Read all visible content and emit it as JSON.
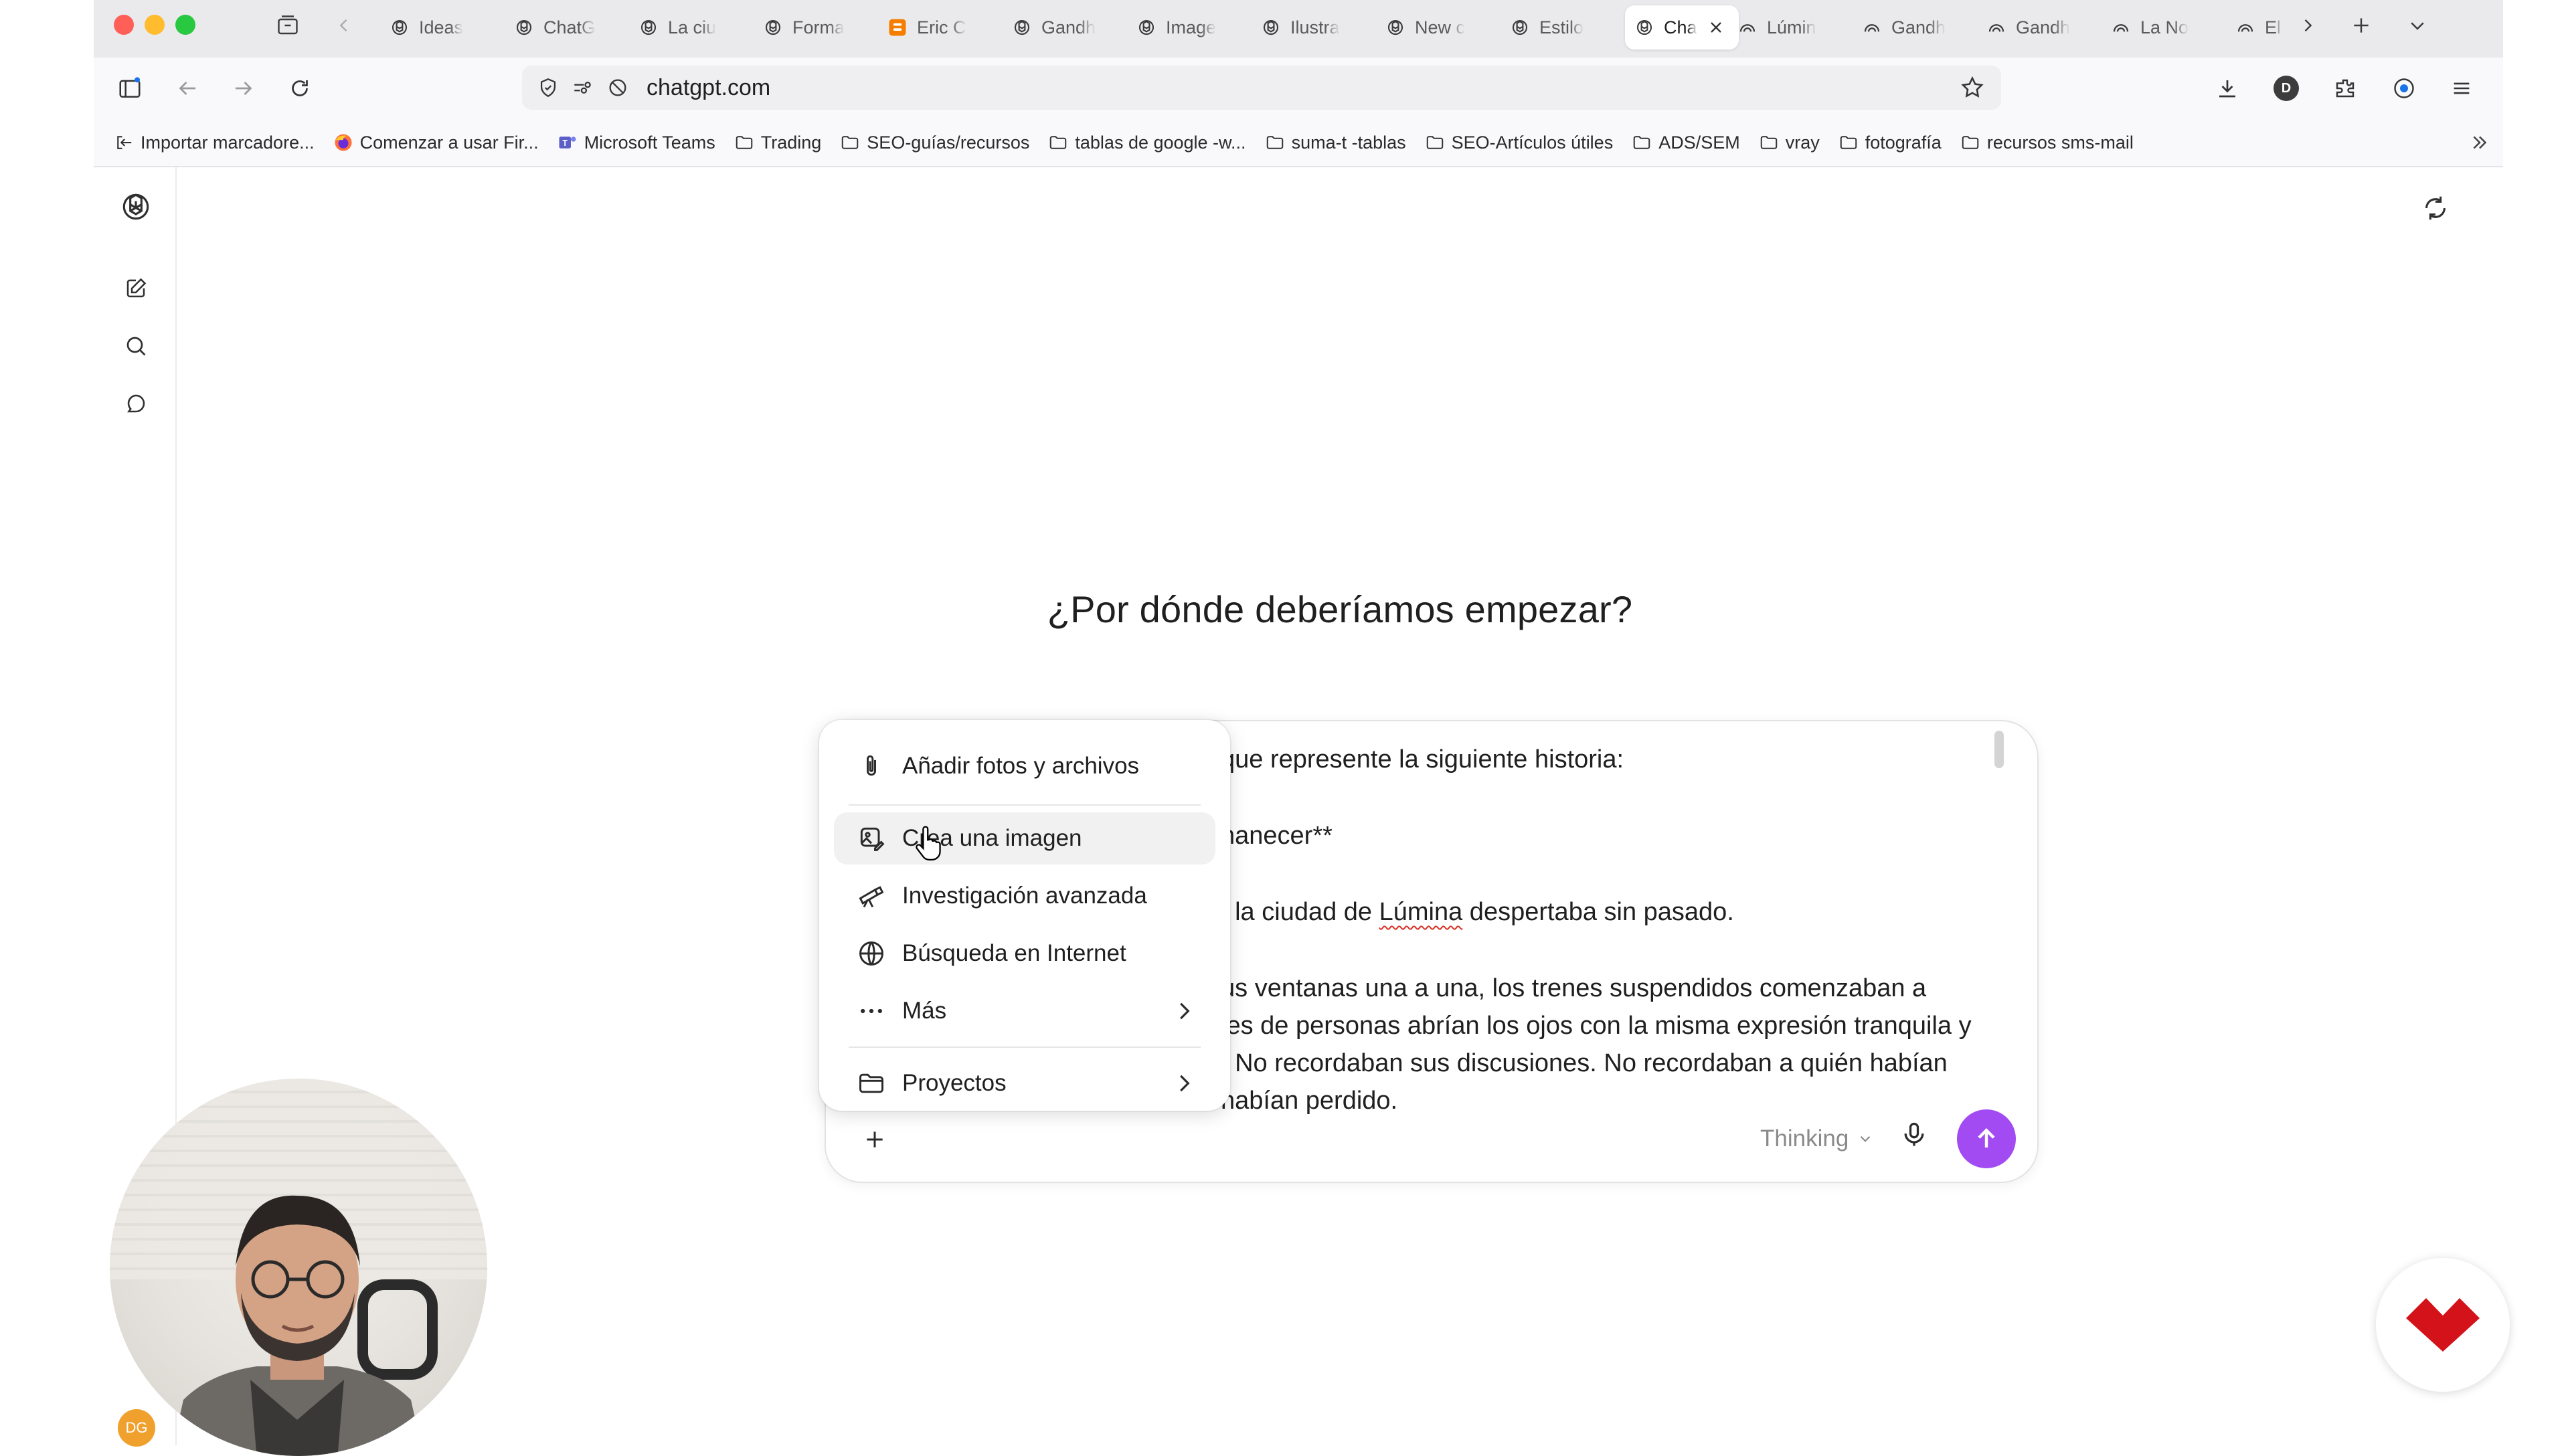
{
  "browser": {
    "tabs": [
      {
        "label": "Ideas",
        "icon": "openai-icon"
      },
      {
        "label": "ChatG",
        "icon": "openai-icon"
      },
      {
        "label": "La ciu",
        "icon": "openai-icon"
      },
      {
        "label": "Forma",
        "icon": "openai-icon"
      },
      {
        "label": "Eric C",
        "icon": "blogger-icon"
      },
      {
        "label": "Gandh",
        "icon": "openai-icon"
      },
      {
        "label": "Image",
        "icon": "openai-icon"
      },
      {
        "label": "Ilustra",
        "icon": "openai-icon"
      },
      {
        "label": "New c",
        "icon": "openai-icon"
      },
      {
        "label": "Estilo",
        "icon": "openai-icon"
      },
      {
        "label": "Cha",
        "icon": "openai-icon",
        "active": true
      },
      {
        "label": "Lúmin",
        "icon": "sora-icon"
      },
      {
        "label": "Gandh",
        "icon": "sora-icon"
      },
      {
        "label": "Gandh",
        "icon": "sora-icon"
      },
      {
        "label": "La No",
        "icon": "sora-icon"
      },
      {
        "label": "El",
        "icon": "sora-icon"
      }
    ],
    "url": "chatgpt.com",
    "profile_initial": "D",
    "bookmarks": [
      {
        "label": "Importar marcadore...",
        "icon": "import-icon"
      },
      {
        "label": "Comenzar a usar Fir...",
        "icon": "firefox-icon"
      },
      {
        "label": "Microsoft Teams",
        "icon": "teams-icon"
      },
      {
        "label": "Trading",
        "icon": "folder-icon"
      },
      {
        "label": "SEO-guías/recursos",
        "icon": "folder-icon"
      },
      {
        "label": "tablas de google -w...",
        "icon": "folder-icon"
      },
      {
        "label": "suma-t -tablas",
        "icon": "folder-icon"
      },
      {
        "label": "SEO-Artículos útiles",
        "icon": "folder-icon"
      },
      {
        "label": "ADS/SEM",
        "icon": "folder-icon"
      },
      {
        "label": "vray",
        "icon": "folder-icon"
      },
      {
        "label": "fotografía",
        "icon": "folder-icon"
      },
      {
        "label": "recursos sms-mail",
        "icon": "folder-icon"
      }
    ]
  },
  "page": {
    "heading": "¿Por dónde deberíamos empezar?",
    "composer": {
      "lines": [
        {
          "text": "que represente la siguiente historia:"
        },
        {
          "text": "nanecer**"
        },
        {
          "before": ", la ciudad de ",
          "misspelled": "Lúmina",
          "after": " despertaba sin pasado."
        },
        {
          "text": "us ventanas una a una, los trenes suspendidos comenzaban a"
        },
        {
          "text": "les de personas abrían los ojos con la misma expresión tranquila y"
        },
        {
          "text": ". No recordaban sus discusiones. No recordaban a quién habían"
        },
        {
          "text": "habían perdido."
        }
      ],
      "model_label": "Thinking"
    },
    "menu": {
      "items": [
        {
          "label": "Añadir fotos y archivos",
          "icon": "paperclip-icon"
        },
        {
          "label": "Crea una imagen",
          "icon": "image-create-icon",
          "hover": true
        },
        {
          "label": "Investigación avanzada",
          "icon": "telescope-icon"
        },
        {
          "label": "Búsqueda en Internet",
          "icon": "globe-icon"
        },
        {
          "label": "Más",
          "icon": "ellipsis-icon",
          "submenu": true
        },
        {
          "label": "Proyectos",
          "icon": "folder-icon",
          "submenu": true
        }
      ]
    }
  },
  "overlay": {
    "avatar_badge": "DG"
  },
  "colors": {
    "send_button": "#a24bf2",
    "brand_logo": "#d3121a",
    "tabbar_bg": "#eaeaed"
  }
}
